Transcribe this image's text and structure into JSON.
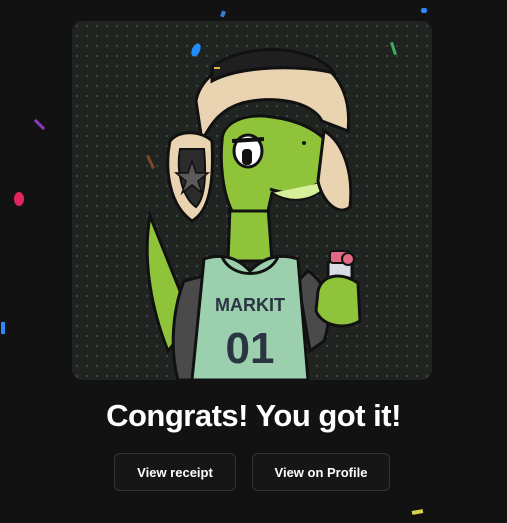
{
  "nft": {
    "image_alt_icon": "lizard-nft-illustration",
    "jersey_text": "MARKIT",
    "jersey_number": "01"
  },
  "headline": "Congrats! You got it!",
  "actions": {
    "view_receipt_label": "View receipt",
    "view_profile_label": "View on Profile"
  },
  "colors": {
    "background": "#121212",
    "card": "#1f2420",
    "lizard_green": "#8fc43a",
    "jersey": "#9ccfae",
    "hat_fur": "#e9d3b1"
  }
}
